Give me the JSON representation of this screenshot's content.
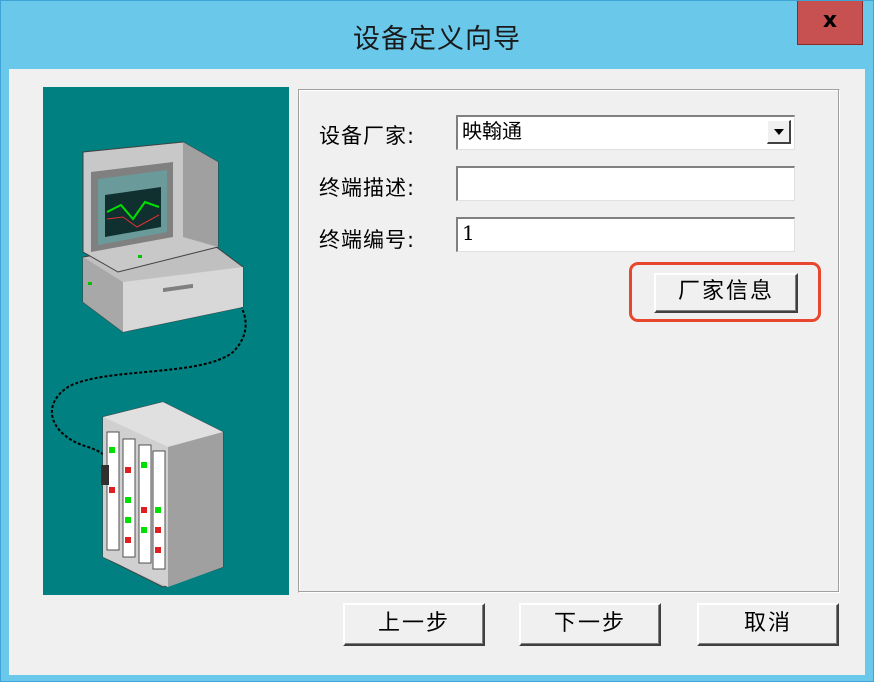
{
  "window": {
    "title": "设备定义向导",
    "close_label": "x"
  },
  "form": {
    "vendor_label": "设备厂家:",
    "vendor_value": "映翰通",
    "desc_label": "终端描述:",
    "desc_value": "",
    "number_label": "终端编号:",
    "number_value": "1",
    "vendor_info_button": "厂家信息"
  },
  "footer": {
    "prev_button": "上一步",
    "next_button": "下一步",
    "cancel_button": "取消"
  },
  "illustration": {
    "icon": "computer-connected-to-device-rack-icon",
    "background": "#008080"
  },
  "colors": {
    "titlebar": "#6ac8ea",
    "close_button": "#c75050",
    "highlight": "#e8472e"
  }
}
